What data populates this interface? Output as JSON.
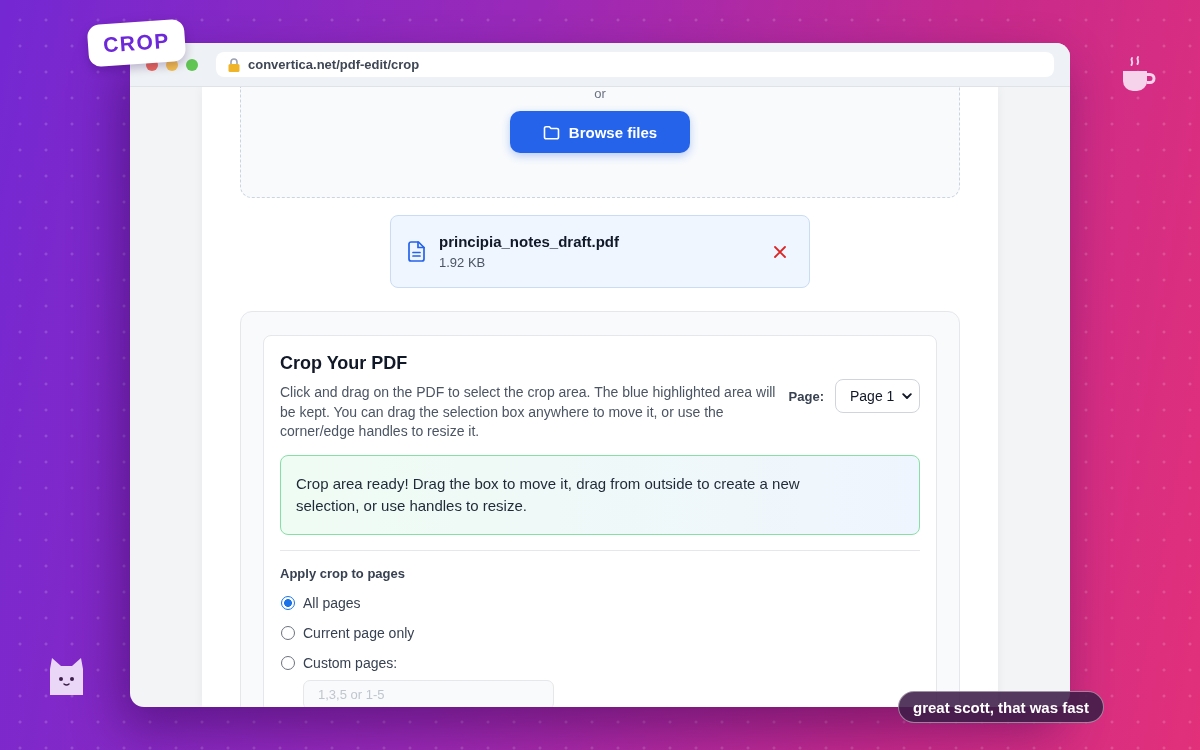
{
  "badge": {
    "text": "CROP"
  },
  "browser": {
    "url": "convertica.net/pdf-edit/crop"
  },
  "upload": {
    "divider_text": "or",
    "button": "Browse files"
  },
  "file": {
    "name": "principia_notes_draft.pdf",
    "size": "1.92 KB"
  },
  "crop_panel": {
    "title": "Crop Your PDF",
    "description": "Click and drag on the PDF to select the crop area. The blue highlighted area will be kept. You can drag the selection box anywhere to move it, or use the corner/edge handles to resize it.",
    "page_label": "Page:",
    "page_select": "Page 1",
    "alert": "Crop area ready! Drag the box to move it, drag from outside to create a new selection, or use handles to resize.",
    "apply_label": "Apply crop to pages",
    "options": [
      {
        "label": "All pages",
        "selected": true
      },
      {
        "label": "Current page only",
        "selected": false
      },
      {
        "label": "Custom pages:",
        "selected": false
      }
    ],
    "custom_pages": {
      "placeholder": "1,3,5 or 1-5"
    }
  },
  "caption": "great scott, that was fast"
}
